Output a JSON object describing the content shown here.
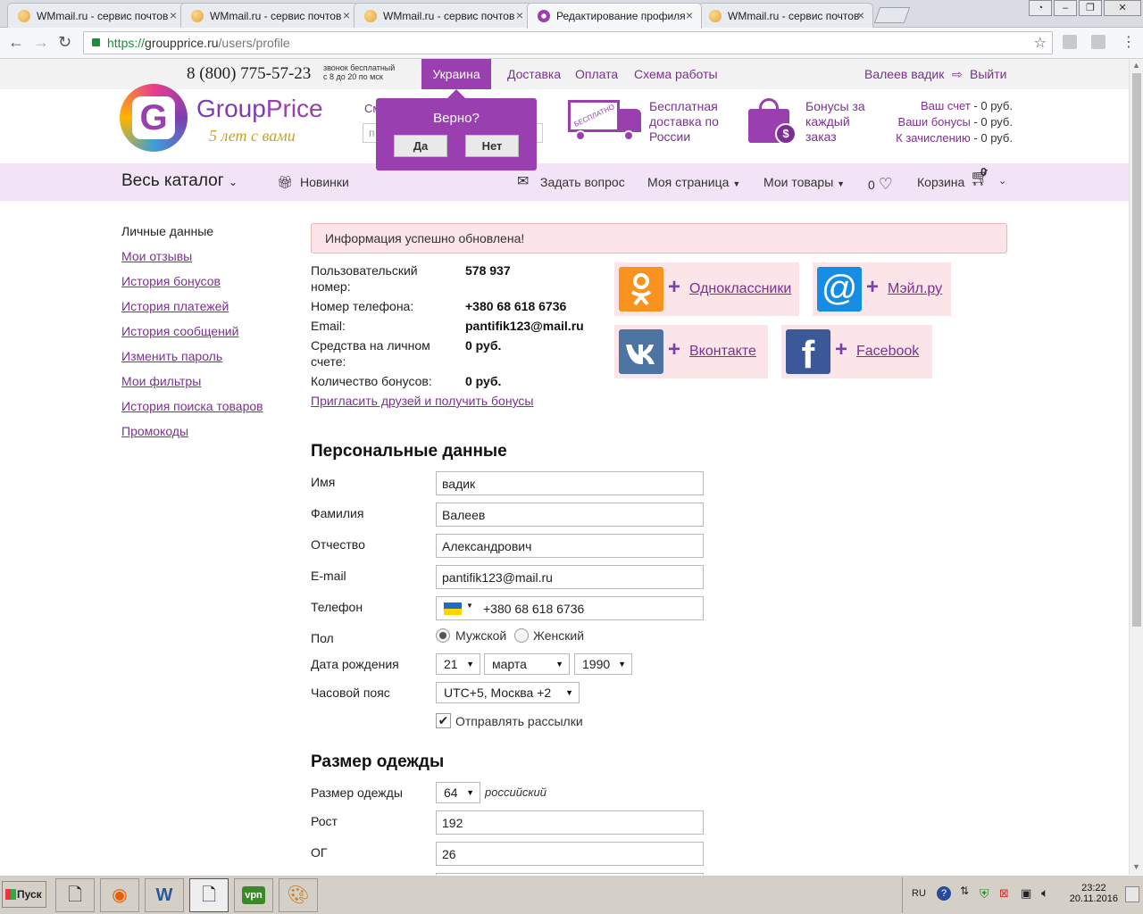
{
  "browser": {
    "tabs": [
      {
        "title": "WMmail.ru - сервис почтов"
      },
      {
        "title": "WMmail.ru - сервис почтов"
      },
      {
        "title": "WMmail.ru - сервис почтов"
      },
      {
        "title": "Редактирование профиля"
      },
      {
        "title": "WMmail.ru - сервис почтов"
      }
    ],
    "url_scheme": "https://",
    "url_host": "groupprice.ru",
    "url_path": "/users/profile"
  },
  "util": {
    "phone": "8 (800) 775-57-23",
    "phone_note_1": "звонок бесплатный",
    "phone_note_2": "с 8 до 20 по мск",
    "country": "Украина",
    "delivery": "Доставка",
    "payment": "Оплата",
    "scheme": "Схема работы",
    "user": "Валеев вадик",
    "logout": "Выйти"
  },
  "popup": {
    "question": "Верно?",
    "yes": "Да",
    "no": "Нет"
  },
  "header": {
    "logo_part1": "Group",
    "logo_part2": "Price",
    "logo_tagline": "5 лет с вами",
    "search_label": "См",
    "search_placeholder": "п",
    "truck_label": "БЕСПЛАТНО",
    "promo_delivery": [
      "Бесплатная",
      "доставка по",
      "России"
    ],
    "promo_bonus": [
      "Бонусы за",
      "каждый",
      "заказ"
    ],
    "account_label": "Ваш счет",
    "account_value": "- 0 руб.",
    "bonus_label": "Ваши бонусы",
    "bonus_value": "- 0 руб.",
    "pending_label": "К зачислению",
    "pending_value": "- 0 руб."
  },
  "nav": {
    "catalog": "Весь каталог",
    "new": "Новинки",
    "ask": "Задать вопрос",
    "my_page": "Моя страница",
    "my_goods": "Мои товары",
    "fav_count": "0",
    "cart": "Корзина",
    "cart_count": "0"
  },
  "sidebar": {
    "items": [
      {
        "label": "Личные данные"
      },
      {
        "label": "Мои отзывы"
      },
      {
        "label": "История бонусов"
      },
      {
        "label": "История платежей"
      },
      {
        "label": "История сообщений"
      },
      {
        "label": "Изменить пароль"
      },
      {
        "label": "Мои фильтры"
      },
      {
        "label": "История поиска товаров"
      },
      {
        "label": "Промокоды"
      }
    ]
  },
  "alert": "Информация успешно обновлена!",
  "info": {
    "user_no_label_1": "Пользовательский",
    "user_no_label_2": "номер:",
    "user_no": "578 937",
    "phone_label": "Номер телефона:",
    "phone": "+380 68 618 6736",
    "email_label": "Email:",
    "email": "pantifik123@mail.ru",
    "funds_label_1": "Средства на личном",
    "funds_label_2": "счете:",
    "funds": "0 руб.",
    "bonus_label": "Количество бонусов:",
    "bonus": "0 руб.",
    "invite": "Пригласить друзей и получить бонусы"
  },
  "social": {
    "ok": "Одноклассники",
    "mail": "Мэйл.ру",
    "vk": "Вконтакте",
    "fb": "Facebook",
    "plus": "+",
    "fb_glyph": "f",
    "mail_glyph": "@"
  },
  "personal": {
    "title": "Персональные данные",
    "first_name_label": "Имя",
    "first_name": "вадик",
    "last_name_label": "Фамилия",
    "last_name": "Валеев",
    "middle_name_label": "Отчество",
    "middle_name": "Александрович",
    "email_label": "E-mail",
    "email": "pantifik123@mail.ru",
    "phone_label": "Телефон",
    "phone": "+380 68 618 6736",
    "gender_label": "Пол",
    "male": "Мужской",
    "female": "Женский",
    "gender_selected": "male",
    "birth_label": "Дата рождения",
    "birth_day": "21",
    "birth_month": "марта",
    "birth_year": "1990",
    "tz_label": "Часовой пояс",
    "tz": "UTC+5, Москва +2",
    "newsletter": "Отправлять рассылки",
    "newsletter_checked": true
  },
  "clothes": {
    "title": "Размер одежды",
    "size_label": "Размер одежды",
    "size": "64",
    "size_system": "российский",
    "height_label": "Рост",
    "height": "192",
    "chest_label": "ОГ",
    "chest": "26"
  },
  "taskbar": {
    "start": "Пуск",
    "vpn": "vpn",
    "lang": "RU",
    "time": "23:22",
    "date": "20.11.2016"
  },
  "colors": {
    "brand": "#9a3fb0",
    "link": "#7d2f93",
    "nav_bg": "#f3e3f6",
    "alert_bg": "#fbe5e8"
  }
}
